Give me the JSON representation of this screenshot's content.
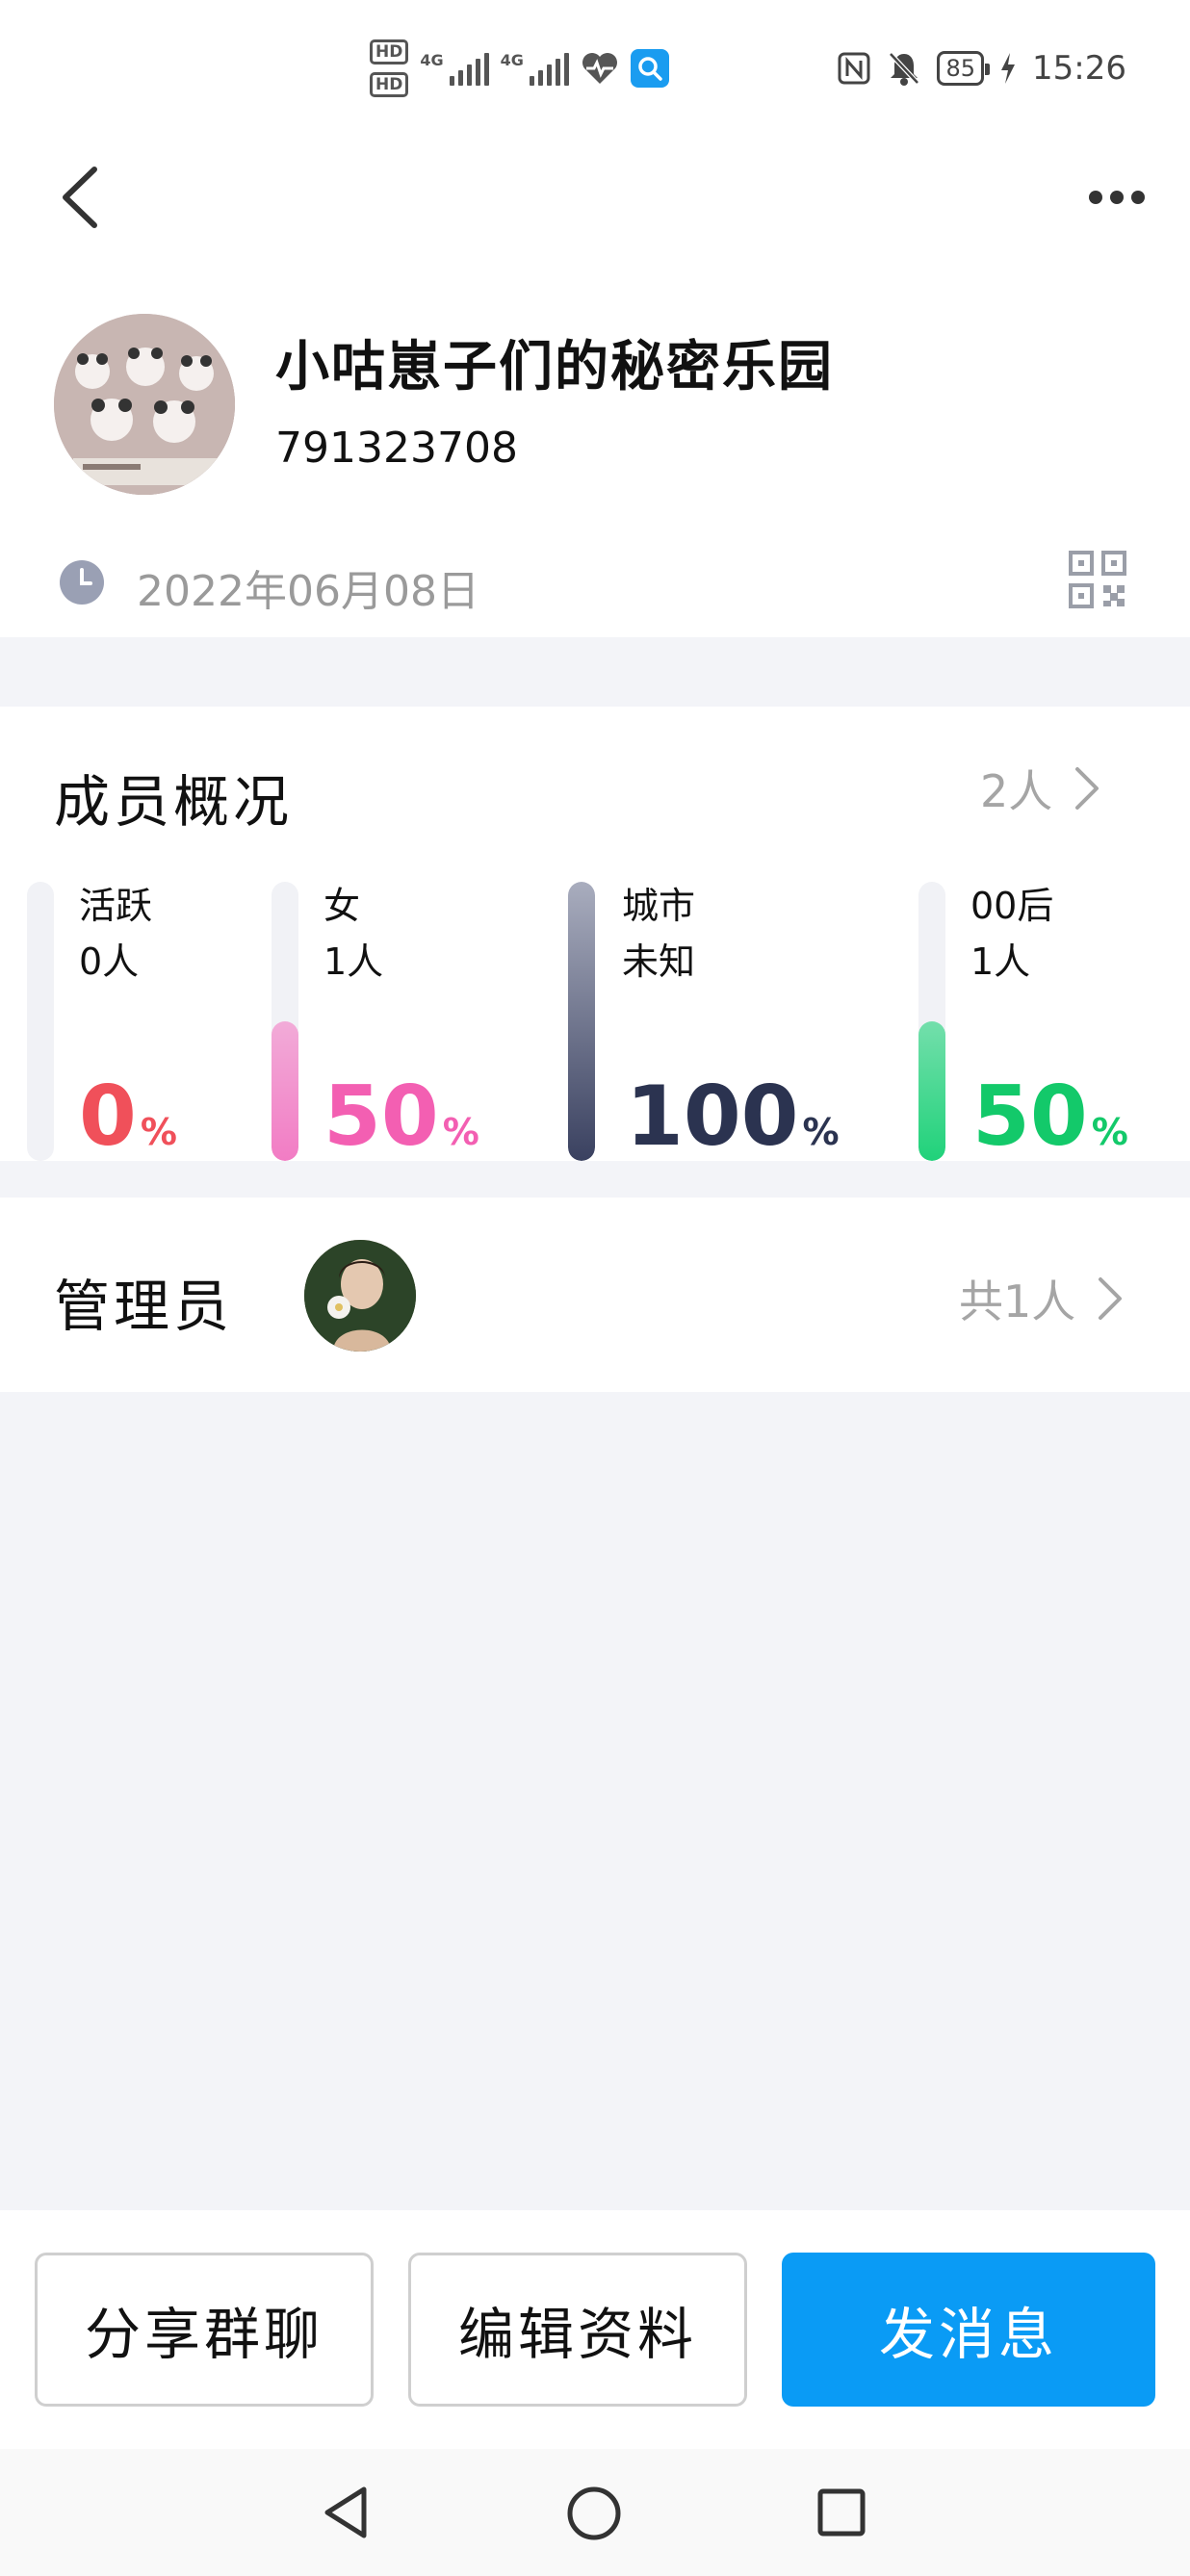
{
  "status_bar": {
    "hd1": "HD",
    "hd2": "HD",
    "net1": "4G",
    "net2": "4G",
    "battery": "85",
    "time": "15:26"
  },
  "group": {
    "name": "小咕崽子们的秘密乐园",
    "id": "791323708",
    "created_date": "2022年06月08日"
  },
  "members": {
    "title": "成员概况",
    "count": "2人",
    "stats": [
      {
        "label": "活跃",
        "value": "0人",
        "percent": 0,
        "percent_text": "0",
        "color": "#f0505a",
        "fill": "#f6f6f9"
      },
      {
        "label": "女",
        "value": "1人",
        "percent": 50,
        "percent_text": "50",
        "color": "#f35fb2",
        "fill": "#f27cc4"
      },
      {
        "label": "城市",
        "value": "未知",
        "percent": 100,
        "percent_text": "100",
        "color": "#2b3350",
        "fill": "#3a4160"
      },
      {
        "label": "00后",
        "value": "1人",
        "percent": 50,
        "percent_text": "50",
        "color": "#13c96a",
        "fill": "#20d27a"
      }
    ],
    "percent_sign": "%"
  },
  "admins": {
    "title": "管理员",
    "count": "共1人"
  },
  "actions": {
    "share": "分享群聊",
    "edit": "编辑资料",
    "send": "发消息"
  }
}
